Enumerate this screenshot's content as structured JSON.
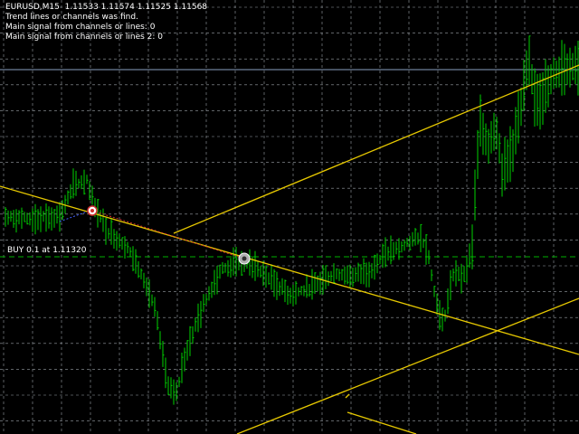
{
  "window": {
    "symbol_timeframe": "EURUSD,M15",
    "ohlc": "1.11533 1.11574 1.11525 1.11568"
  },
  "messages": [
    "Trend lines or channels was find.",
    "Main signal from channels or lines: 0",
    "Main signal from channels or lines 2: 0"
  ],
  "order": {
    "label": "BUY 0.1 at 1.11320"
  },
  "colors": {
    "background": "#000000",
    "grid": "#9aa0a6",
    "candles": "#00d200",
    "trendline": "#e6c800",
    "order_line": "#00b000",
    "bid_line": "#8aa0c0",
    "text": "#ffffff"
  },
  "icons": {
    "entry_arrow": "buy-arrow-icon",
    "close_marker": "close-marker-icon"
  }
}
